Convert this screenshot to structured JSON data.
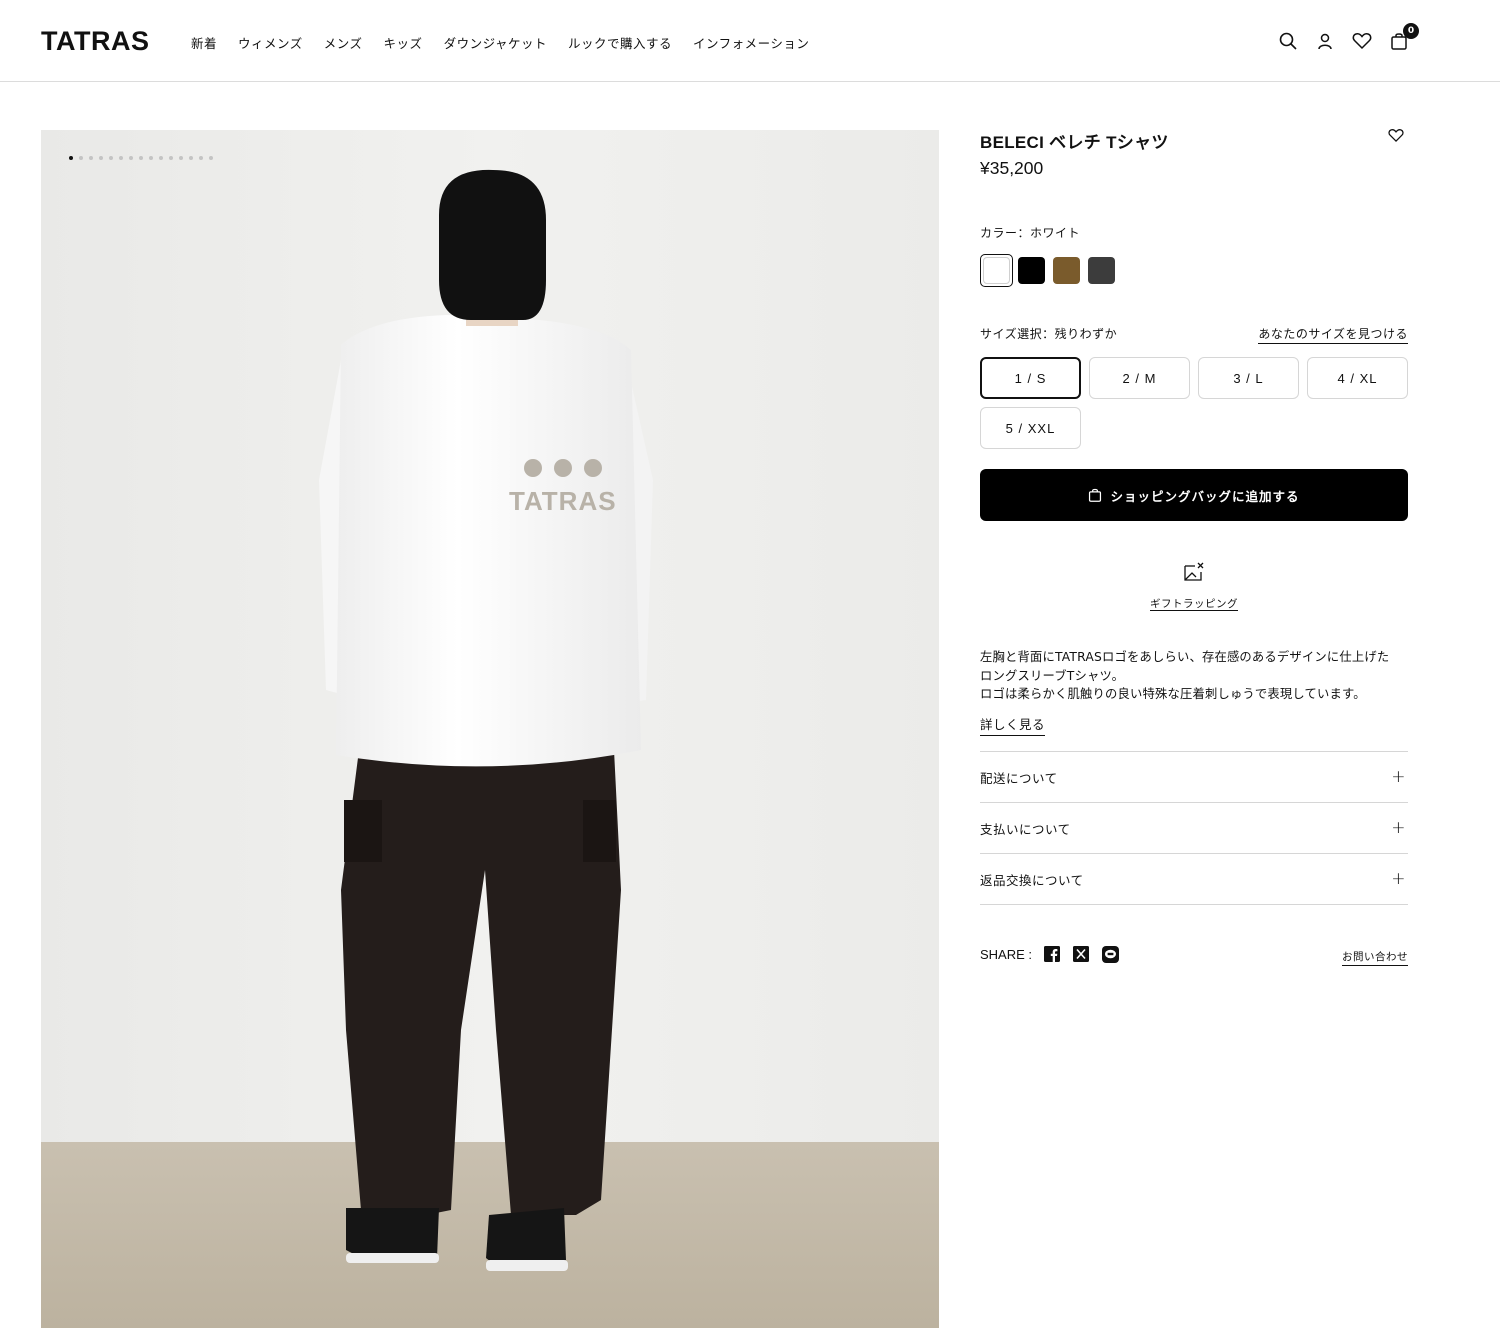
{
  "header": {
    "logo": "TATRAS",
    "nav": [
      "新着",
      "ウィメンズ",
      "メンズ",
      "キッズ",
      "ダウンジャケット",
      "ルックで購入する",
      "インフォメーション"
    ],
    "cart_count": "0"
  },
  "gallery": {
    "image_count": 15,
    "active_index": 0,
    "print_text": "TATRAS"
  },
  "product": {
    "title": "BELECI ベレチ Tシャツ",
    "price": "¥35,200",
    "color_label": "カラー：ホワイト",
    "colors": [
      {
        "name": "ホワイト",
        "hex": "#ffffff",
        "selected": true
      },
      {
        "name": "ブラック",
        "hex": "#000000",
        "selected": false
      },
      {
        "name": "ブラウン",
        "hex": "#7a5b2c",
        "selected": false
      },
      {
        "name": "グレー",
        "hex": "#3c3c3c",
        "selected": false
      }
    ],
    "size_label": "サイズ選択：残りわずか",
    "size_guide": "あなたのサイズを見つける",
    "sizes": [
      "1 / S",
      "2 / M",
      "3 / L",
      "4 / XL",
      "5 / XXL"
    ],
    "selected_size": "1 / S",
    "add_to_bag": "ショッピングバッグに追加する",
    "gift_wrapping": "ギフトラッピング",
    "description_lines": [
      "左胸と背面にTATRASロゴをあしらい、存在感のあるデザインに仕上げた",
      "ロングスリーブTシャツ。",
      "ロゴは柔らかく肌触りの良い特殊な圧着刺しゅうで表現しています。"
    ],
    "more": "詳しく見る",
    "accordions": [
      "配送について",
      "支払いについて",
      "返品交換について"
    ],
    "share_label": "SHARE :",
    "contact": "お問い合わせ"
  }
}
